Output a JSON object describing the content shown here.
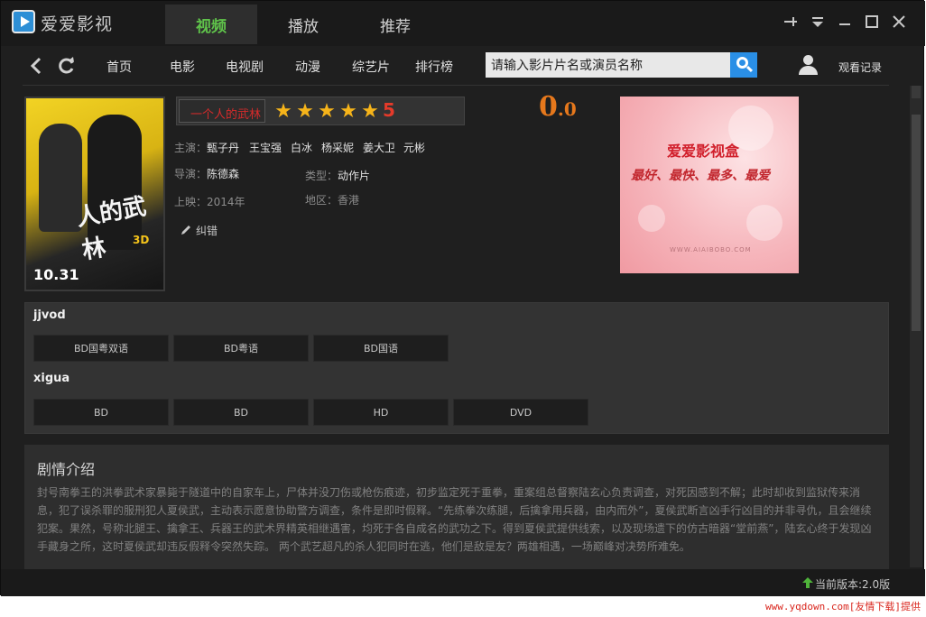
{
  "app": {
    "title": "爱爱影视",
    "tabs": [
      {
        "label": "视频",
        "active": true
      },
      {
        "label": "播放",
        "active": false
      },
      {
        "label": "推荐",
        "active": false
      }
    ],
    "window_controls": [
      "pin-icon",
      "dropdown-icon",
      "minimize-icon",
      "maximize-icon",
      "close-icon"
    ]
  },
  "nav": {
    "items": [
      "首页",
      "电影",
      "电视剧",
      "动漫",
      "综艺片",
      "排行榜"
    ],
    "search_placeholder": "请输入影片片名或演员名称",
    "history_label": "观看记录"
  },
  "movie": {
    "title": "一个人的武林",
    "stars": 5,
    "star_score": "5",
    "rating_int": "0",
    "rating_dec": ".0",
    "cast_label": "主演：",
    "cast": [
      "甄子丹",
      "王宝强",
      "白冰",
      "杨采妮",
      "姜大卫",
      "元彬"
    ],
    "director_label": "导演：",
    "director": "陈德森",
    "genre_label": "类型：",
    "genre": "动作片",
    "release_label": "上映：",
    "release": "2014年",
    "region_label": "地区：",
    "region": "香港",
    "report_label": "纠错",
    "poster": {
      "title_text": "人的武林",
      "date_text": "10.31",
      "badge_text": "3D"
    }
  },
  "ad": {
    "title": "爱爱影视盒",
    "slogan": "最好、最快、最多、最爱",
    "url": "WWW.AIAIBOBO.COM"
  },
  "sources": [
    {
      "name": "jjvod",
      "options": [
        "BD国粤双语",
        "BD粤语",
        "BD国语"
      ]
    },
    {
      "name": "xigua",
      "options": [
        "BD",
        "BD",
        "HD",
        "DVD"
      ]
    }
  ],
  "synopsis": {
    "title": "剧情介绍",
    "text": "封号南拳王的洪拳武术家暴毙于隧道中的自家车上，尸体并没刀伤或枪伤痕迹，初步监定死于重拳，重案组总督察陆玄心负责调查，对死因感到不解；此时却收到监狱传来消息，犯了误杀罪的服刑犯人夏侯武，主动表示愿意协助警方调查，条件是即时假释。“先练拳次练腿，后擒拿用兵器，由内而外”，夏侯武断言凶手行凶目的并非寻仇，且会继续犯案。果然，号称北腿王、擒拿王、兵器王的武术界精英相继遇害，均死于各自成名的武功之下。得到夏侯武提供线索，以及现场遗下的仿古暗器“堂前燕”，陆玄心终于发现凶手藏身之所，这时夏侯武却违反假释令突然失踪。 两个武艺超凡的杀人犯同时在逃，他们是敌是友？两雄相遇，一场巅峰对决势所难免。"
  },
  "status": {
    "version_label": "当前版本:2.0版"
  },
  "watermark": "www.yqdown.com[友情下载]提供",
  "colors": {
    "accent_green": "#5fc24a",
    "title_red": "#d62b2b",
    "star_gold": "#f6b41a",
    "rating_orange": "#e6781c",
    "search_blue": "#2a8fe6"
  }
}
